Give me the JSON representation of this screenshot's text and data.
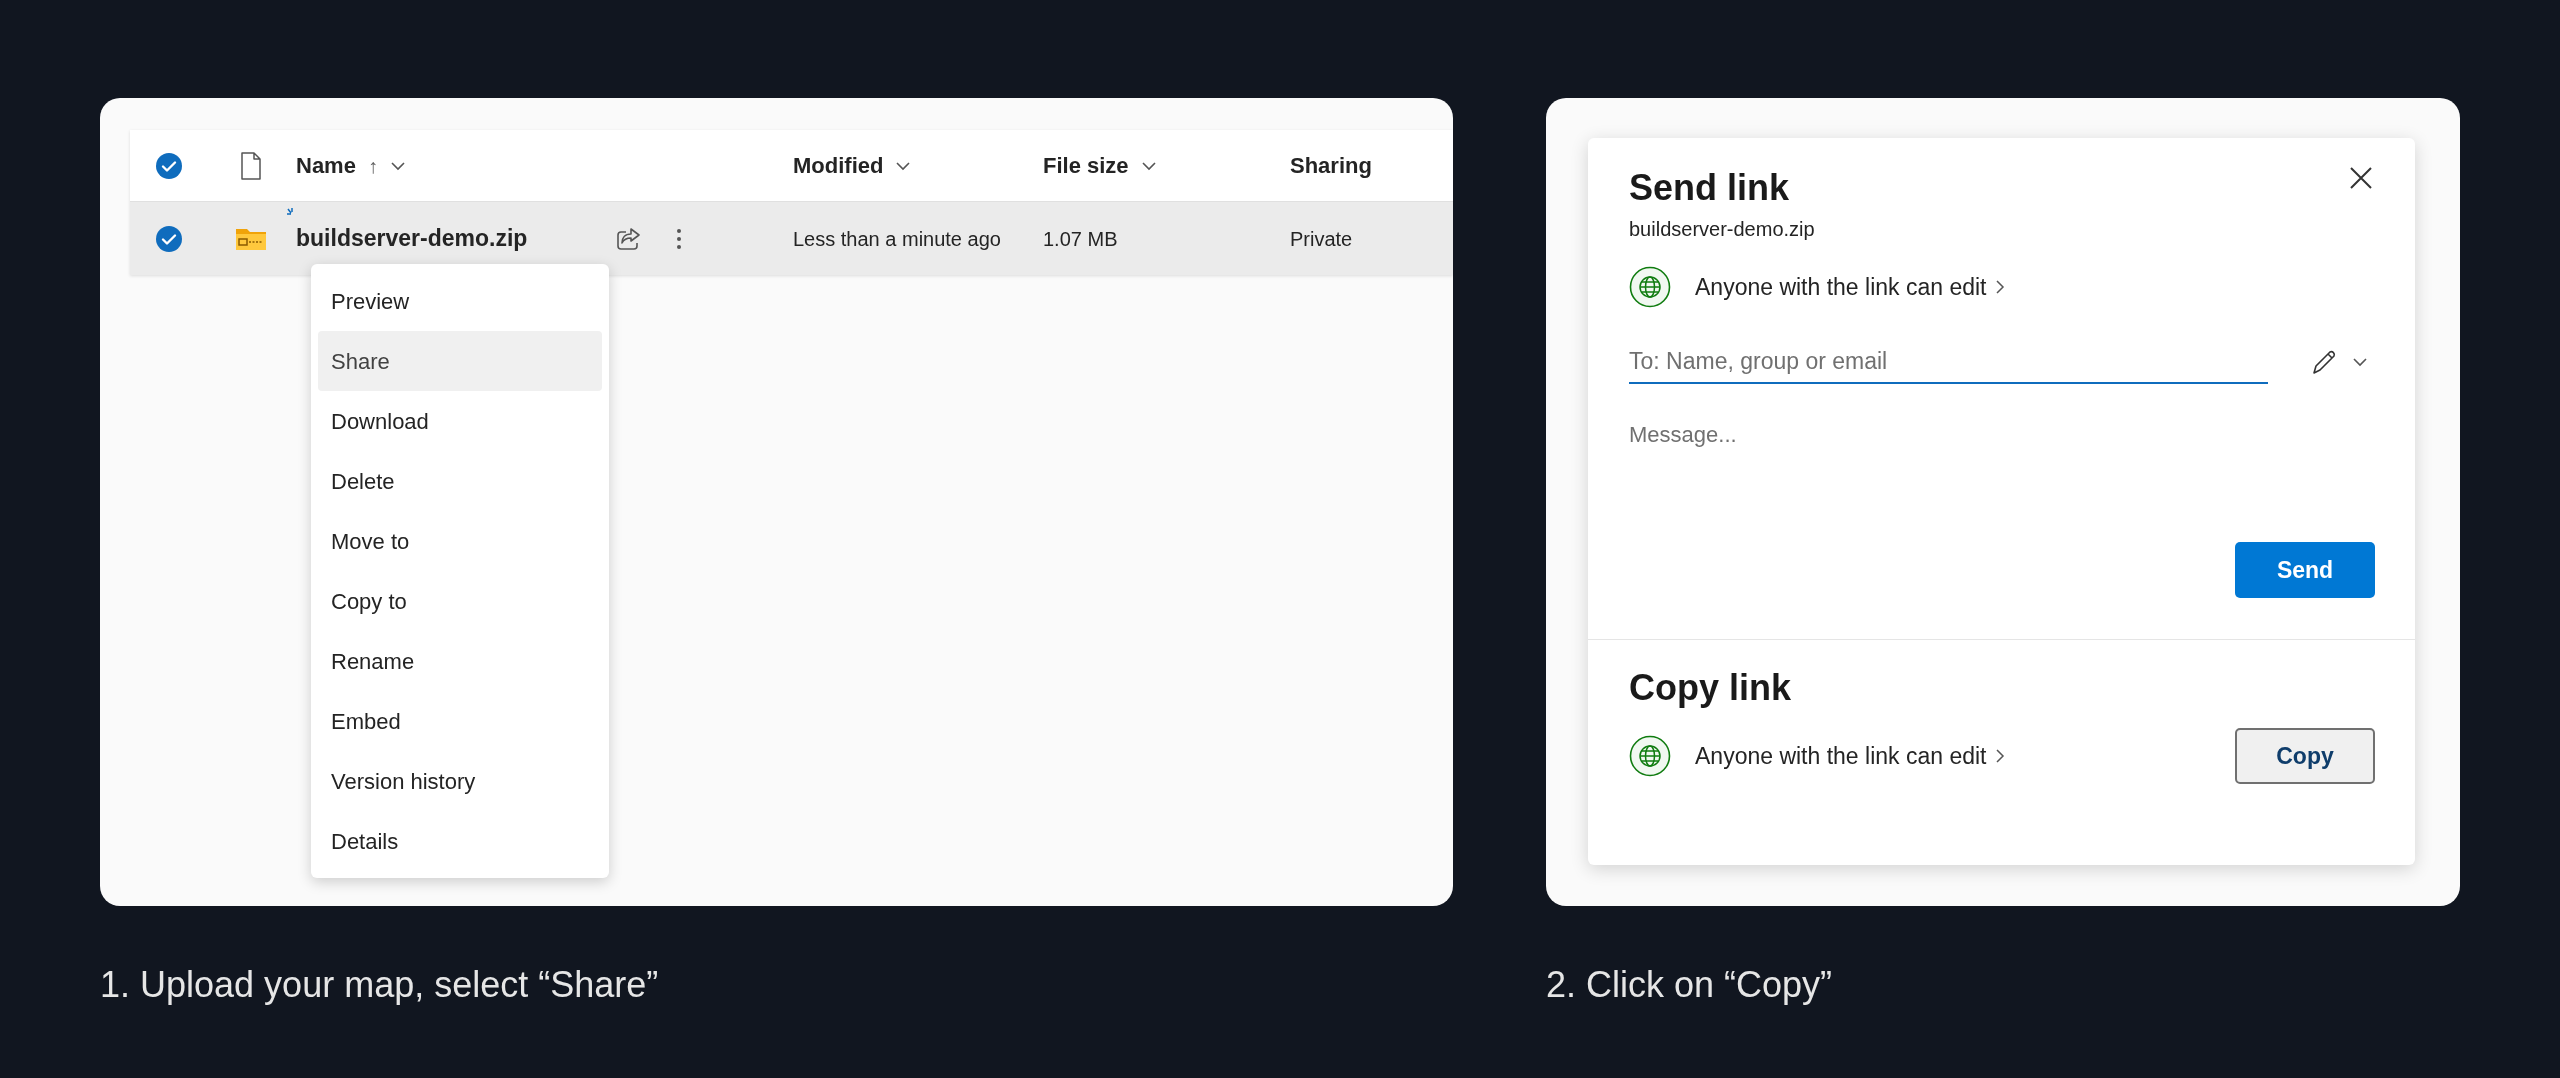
{
  "steps": [
    {
      "caption": "1. Upload your map, select “Share”",
      "kind": "files"
    },
    {
      "caption": "2. Click on “Copy”",
      "kind": "share"
    }
  ],
  "file_list": {
    "columns": [
      {
        "label": "Name",
        "sort": "↑"
      },
      {
        "label": "Modified"
      },
      {
        "label": "File size"
      },
      {
        "label": "Sharing"
      }
    ],
    "header_checked": true,
    "rows": [
      {
        "name": "buildserver-demo.zip",
        "modified": "Less than a minute ago",
        "size": "1.07 MB",
        "sharing": "Private",
        "selected": true
      }
    ],
    "menu": [
      {
        "label": "Preview",
        "selected": false
      },
      {
        "label": "Share",
        "selected": true
      },
      {
        "label": "Download",
        "selected": false
      },
      {
        "label": "Delete",
        "selected": false
      },
      {
        "label": "Move to",
        "selected": false
      },
      {
        "label": "Copy to",
        "selected": false
      },
      {
        "label": "Rename",
        "selected": false
      },
      {
        "label": "Embed",
        "selected": false
      },
      {
        "label": "Version history",
        "selected": false
      },
      {
        "label": "Details",
        "selected": false
      }
    ]
  },
  "dialog": {
    "title": "Send link",
    "filename": "buildserver-demo.zip",
    "permission": "Anyone with the link can edit",
    "to_placeholder": "To: Name, group or email",
    "message_placeholder": "Message...",
    "send": "Send",
    "copy_title": "Copy link",
    "copy_permission": "Anyone with the link can edit",
    "copy": "Copy"
  }
}
